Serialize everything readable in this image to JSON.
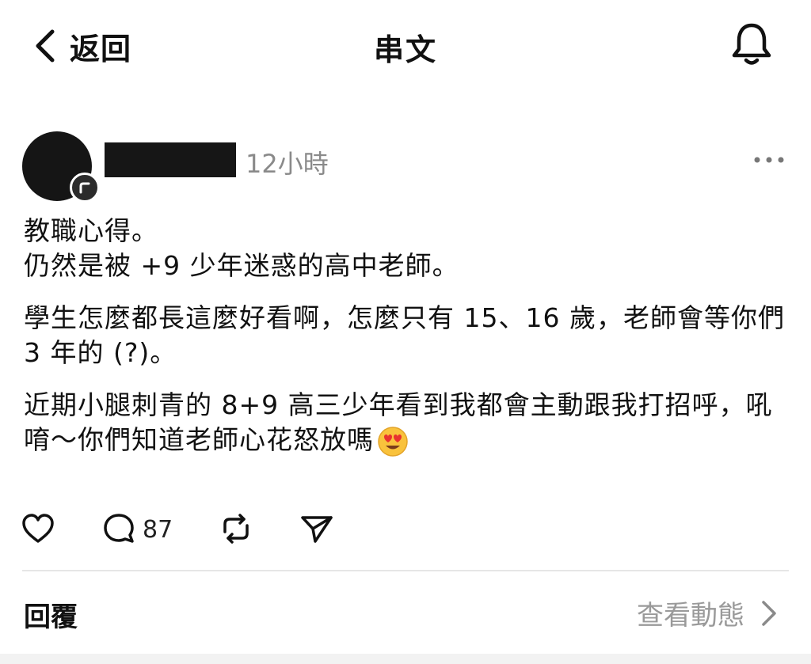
{
  "header": {
    "back_label": "返回",
    "title": "串文",
    "back_icon": "chevron-left-icon",
    "bell_icon": "bell-icon"
  },
  "post": {
    "timestamp": "12小時",
    "line1": "教職心得。",
    "line2": "仍然是被 +9 少年迷惑的高中老師。",
    "para2": "學生怎麼都長這麼好看啊，怎麼只有 15、16 歲，老師會等你們 3 年的 (?)。",
    "para3": "近期小腿刺青的 8+9 高三少年看到我都會主動跟我打招呼，吼唷～你們知道老師心花怒放嗎",
    "emoji": "heart-eyes-emoji",
    "reply_count": "87"
  },
  "actions": {
    "like_icon": "heart-icon",
    "comment_icon": "comment-icon",
    "repost_icon": "repost-icon",
    "share_icon": "send-icon"
  },
  "footer": {
    "replies_label": "回覆",
    "view_activity_label": "查看動態"
  },
  "colors": {
    "text": "#111111",
    "muted": "#8a8a8a",
    "divider": "#e6e6e6"
  }
}
